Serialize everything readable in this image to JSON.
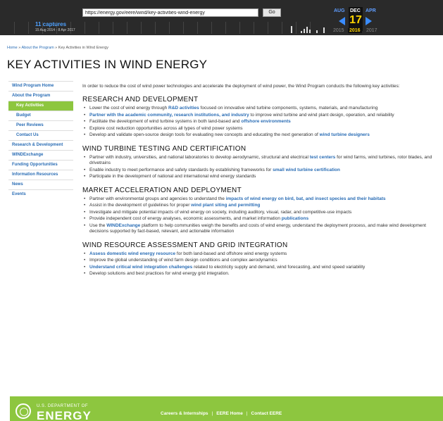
{
  "wayback": {
    "url": "https://energy.gov/eere/wind/key-activities-wind-energy",
    "go_label": "Go",
    "captures": "11 captures",
    "date_range": "15 Aug 2014 - 8 Apr 2017",
    "month_prev": "AUG",
    "month_current": "DEC",
    "month_next": "APR",
    "day": "17",
    "year_prev": "2015",
    "year_current": "2016",
    "year_next": "2017"
  },
  "breadcrumb": {
    "home": "Home",
    "sep1": " » ",
    "about": "About the Program",
    "sep2": " » ",
    "current": "Key Activities in Wind Energy"
  },
  "page_title": "KEY ACTIVITIES IN WIND ENERGY",
  "sidebar": {
    "items": [
      {
        "label": "Wind Program Home",
        "sub": false,
        "active": false
      },
      {
        "label": "About the Program",
        "sub": false,
        "active": false
      },
      {
        "label": "Key Activities",
        "sub": true,
        "active": true
      },
      {
        "label": "Budget",
        "sub": true,
        "active": false
      },
      {
        "label": "Peer Reviews",
        "sub": true,
        "active": false
      },
      {
        "label": "Contact Us",
        "sub": true,
        "active": false
      },
      {
        "label": "Research & Development",
        "sub": false,
        "active": false
      },
      {
        "label": "WINDExchange",
        "sub": false,
        "active": false
      },
      {
        "label": "Funding Opportunities",
        "sub": false,
        "active": false
      },
      {
        "label": "Information Resources",
        "sub": false,
        "active": false
      },
      {
        "label": "News",
        "sub": false,
        "active": false
      },
      {
        "label": "Events",
        "sub": false,
        "active": false
      }
    ]
  },
  "intro": "In order to reduce the cost of wind power technologies and accelerate the deployment of wind power, the Wind Program conducts the following key activities:",
  "sections": [
    {
      "heading": "RESEARCH AND DEVELOPMENT",
      "items": [
        [
          {
            "t": "Lower the cost of wind energy through "
          },
          {
            "t": "R&D activities",
            "link": true
          },
          {
            "t": " focused on innovative wind turbine components, systems, materials, and manufacturing"
          }
        ],
        [
          {
            "t": "Partner with the academic community, research institutions, and industry",
            "link": true
          },
          {
            "t": " to improve wind turbine and wind plant design, operation, and reliability"
          }
        ],
        [
          {
            "t": "Facilitate the development of wind turbine systems in both land-based and "
          },
          {
            "t": "offshore environments",
            "link": true
          }
        ],
        [
          {
            "t": "Explore cost reduction opportunities across all types of wind power systems"
          }
        ],
        [
          {
            "t": "Develop and validate open-source design tools for evaluating new concepts and educating the next generation of "
          },
          {
            "t": "wind turbine designers",
            "link": true
          }
        ]
      ]
    },
    {
      "heading": "WIND TURBINE TESTING AND CERTIFICATION",
      "items": [
        [
          {
            "t": "Partner with industry, universities, and national laboratories to develop aerodynamic, structural and electrical "
          },
          {
            "t": "test centers",
            "link": true
          },
          {
            "t": " for wind farms, wind turbines, rotor blades, and drivetrains"
          }
        ],
        [
          {
            "t": "Enable industry to meet performance and safety standards by establishing frameworks for "
          },
          {
            "t": "small wind turbine certification",
            "link": true
          }
        ],
        [
          {
            "t": "Participate in the development of national and international wind energy standards"
          }
        ]
      ]
    },
    {
      "heading": "MARKET ACCELERATION AND DEPLOYMENT",
      "items": [
        [
          {
            "t": "Partner with environmental groups and agencies to understand the "
          },
          {
            "t": "impacts of wind energy on bird, bat, and insect species and their habitats",
            "link": true
          }
        ],
        [
          {
            "t": "Assist in the development of guidelines for proper "
          },
          {
            "t": "wind plant siting and permitting",
            "link": true
          }
        ],
        [
          {
            "t": "Investigate and mitigate potential impacts of wind energy on society, including auditory, visual, radar, and competitive-use impacts"
          }
        ],
        [
          {
            "t": "Provide independent cost of energy analyses, economic assessments, and market information "
          },
          {
            "t": "publications",
            "link": true
          }
        ],
        [
          {
            "t": "Use the "
          },
          {
            "t": "WINDExchange",
            "link": true
          },
          {
            "t": " platform to help communities weigh the benefits and costs of wind energy, understand the deployment process, and make wind development decisions supported by fact-based, relevant, and actionable information"
          }
        ]
      ]
    },
    {
      "heading": "WIND RESOURCE ASSESSMENT AND GRID INTEGRATION",
      "items": [
        [
          {
            "t": "Assess domestic wind energy resource",
            "link": true
          },
          {
            "t": " for both land-based and offshore wind energy systems"
          }
        ],
        [
          {
            "t": "Improve the global understanding of wind farm design conditions and complex aerodynamics"
          }
        ],
        [
          {
            "t": "Understand critical wind integration challenges",
            "link": true
          },
          {
            "t": " related to electricity supply and demand, wind forecasting, and wind speed variability"
          }
        ],
        [
          {
            "t": "Develop solutions and best practices for wind energy grid integration."
          }
        ]
      ]
    }
  ],
  "footer": {
    "dept_small": "U.S. DEPARTMENT OF",
    "dept_big": "ENERGY",
    "links": [
      "Careers & Internships",
      "EERE Home",
      "Contact EERE"
    ],
    "sep": "|"
  },
  "colors": {
    "accent_green": "#8dc63f",
    "link_blue": "#2a6db5",
    "wayback_bg": "#2a2a2a",
    "wayback_day": "#ffd400"
  }
}
